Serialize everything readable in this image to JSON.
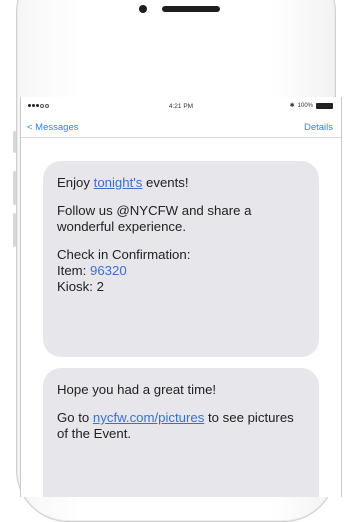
{
  "status": {
    "time": "4:21 PM",
    "battery": "100%"
  },
  "nav": {
    "back": "< Messages",
    "details": "Details"
  },
  "messages": [
    {
      "line1_pre": "Enjoy ",
      "line1_link": "tonight's",
      "line1_post": " events!",
      "line2": "Follow us @NYCFW and share a wonderful experience.",
      "line3": "Check in Confirmation:",
      "item_label": "Item: ",
      "item_value": "96320",
      "kiosk": "Kiosk: 2"
    },
    {
      "line1": "Hope you had a great time!",
      "line2_pre": "Go to ",
      "line2_link": "nycfw.com/pictures",
      "line2_post": " to see pictures of the Event."
    }
  ]
}
